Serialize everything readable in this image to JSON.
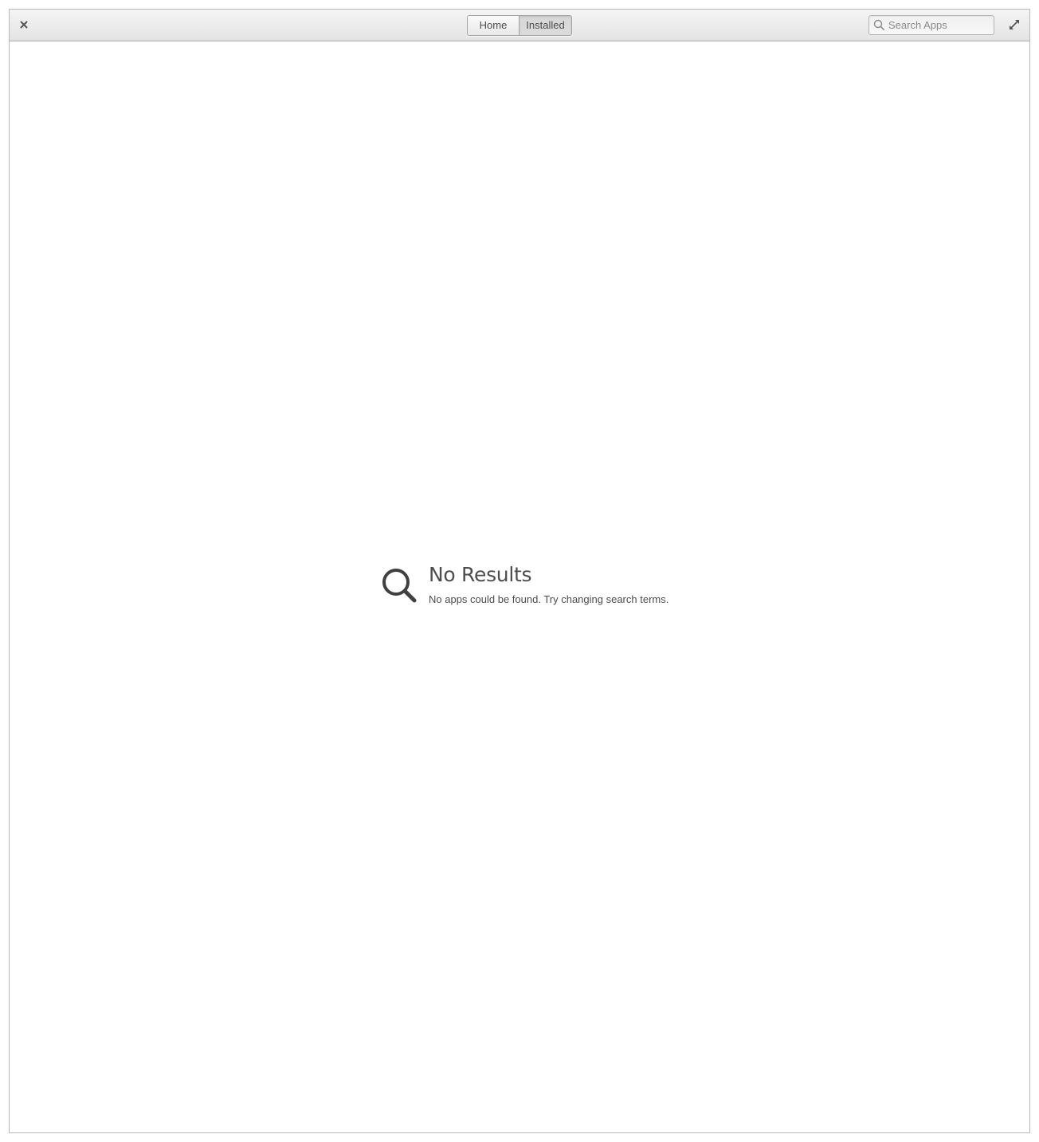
{
  "header": {
    "close_icon": "close-icon",
    "view_switcher": {
      "items": [
        {
          "label": "Home",
          "selected": false
        },
        {
          "label": "Installed",
          "selected": true
        }
      ]
    },
    "search": {
      "placeholder": "Search Apps",
      "value": "",
      "icon": "search-icon"
    },
    "fullscreen_icon": "fullscreen-icon"
  },
  "main": {
    "empty_state": {
      "icon": "search-icon",
      "title": "No Results",
      "description": "No apps could be found. Try changing search terms."
    }
  },
  "colors": {
    "text": "#4d4d4d",
    "header_top": "#f4f4f4",
    "header_bottom": "#e4e4e4",
    "background": "#ffffff"
  }
}
